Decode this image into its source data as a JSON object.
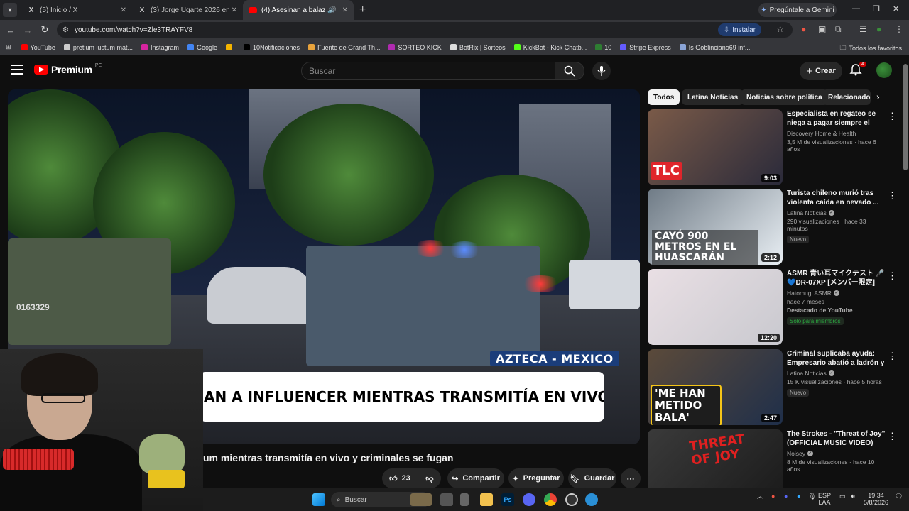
{
  "browser": {
    "tabs": [
      {
        "title": "(5) Inicio / X",
        "favicon": "X"
      },
      {
        "title": "(3) Jorge Ugarte 2026 en X: \"M...",
        "favicon": "X"
      },
      {
        "title": "(4) Asesinan a balazos al inf...",
        "favicon": "YT"
      }
    ],
    "gemini_label": "Pregúntale a Gemini",
    "url": "youtube.com/watch?v=Zle3TRAYFV8",
    "install_label": "Instalar",
    "bookmarks": [
      {
        "label": "YouTube",
        "color": "#ff0000"
      },
      {
        "label": "pretium iustum mat...",
        "color": "#cccccc"
      },
      {
        "label": "Instagram",
        "color": "#d6249f"
      },
      {
        "label": "Google",
        "color": "#4285f4"
      },
      {
        "label": "",
        "color": "#f4b400"
      },
      {
        "label": "10Notificaciones",
        "color": "#000000"
      },
      {
        "label": "Fuente de Grand Th...",
        "color": "#e8a33c"
      },
      {
        "label": "SORTEO KICK",
        "color": "#b02bb0"
      },
      {
        "label": "BotRix | Sorteos",
        "color": "#dddddd"
      },
      {
        "label": "KickBot - Kick Chatb...",
        "color": "#53fc18"
      },
      {
        "label": "10",
        "color": "#2e7d32"
      },
      {
        "label": "Stripe Express",
        "color": "#635bff"
      },
      {
        "label": "Is Goblinciano69 inf...",
        "color": "#8aa4d6"
      }
    ],
    "all_bookmarks_label": "Todos los favoritos"
  },
  "youtube": {
    "logo_text": "Premium",
    "region": "PE",
    "search_placeholder": "Buscar",
    "create_label": "Crear",
    "notifications_count": "4"
  },
  "video": {
    "overlay_source": "AZTECA - MEXICO",
    "overlay_headline": "AN A INFLUENCER MIENTRAS TRANSMITÍA EN VIVO",
    "unit_number": "0163329",
    "title": "um mientras transmitía en vivo y criminales se fugan",
    "likes": "23",
    "share_label": "Compartir",
    "ask_label": "Preguntar",
    "save_label": "Guardar"
  },
  "chips": [
    "Todos",
    "Latina Noticias",
    "Noticias sobre política",
    "Relacionados"
  ],
  "recommendations": [
    {
      "title": "Especialista en regateo se niega a pagar siempre el total | ...",
      "channel": "Discovery Home & Health",
      "verified": false,
      "views": "3,5 M de visualizaciones · hace 6 años",
      "badge": "",
      "extra": "",
      "duration": "9:03",
      "thumb_text": "TLC",
      "thumb_colors": [
        "#7a5a48",
        "#2a2a3a"
      ]
    },
    {
      "title": "Turista chileno murió tras violenta caída en nevado ...",
      "channel": "Latina Noticias",
      "verified": true,
      "views": "290 visualizaciones · hace 33 minutos",
      "badge": "Nuevo",
      "extra": "",
      "duration": "2:12",
      "thumb_text": "CAYÓ 900 METROS EN EL HUASCARÁN",
      "thumb_colors": [
        "#6f7b86",
        "#e8eef3"
      ]
    },
    {
      "title": "ASMR 青い耳マイクテスト 🎤 💙DR-07XP [メンバー限定]",
      "channel": "Hatomugi ASMR",
      "verified": true,
      "views": "hace 7 meses",
      "badge": "Solo para miembros",
      "extra": "Destacado de YouTube",
      "duration": "12:20",
      "thumb_text": "",
      "thumb_colors": [
        "#e9dfe4",
        "#c9c9cf"
      ]
    },
    {
      "title": "Criminal suplicaba ayuda: Empresario abatió a ladrón y ...",
      "channel": "Latina Noticias",
      "verified": true,
      "views": "15 K visualizaciones · hace 5 horas",
      "badge": "Nuevo",
      "extra": "",
      "duration": "2:47",
      "thumb_text": "'ME HAN METIDO BALA'",
      "thumb_colors": [
        "#5b4a3a",
        "#1f2f4a"
      ]
    },
    {
      "title": "The Strokes - \"Threat of Joy\" (OFFICIAL MUSIC VIDEO)",
      "channel": "Noisey",
      "verified": true,
      "views": "8 M de visualizaciones · hace 10 años",
      "badge": "",
      "extra": "",
      "duration": "",
      "thumb_text": "THREAT OF JOY",
      "thumb_colors": [
        "#3a3a3a",
        "#1a1a1a"
      ]
    }
  ],
  "taskbar": {
    "search_label": "Buscar",
    "lang_top": "ESP",
    "lang_bottom": "LAA",
    "time": "19:34",
    "date": "5/8/2026"
  }
}
